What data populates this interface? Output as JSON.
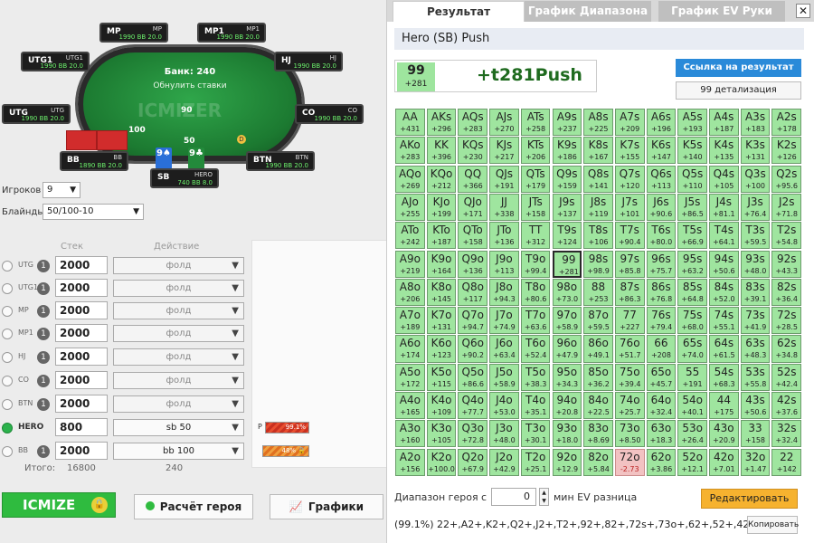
{
  "table": {
    "bank_label": "Банк: 240",
    "refresh_label": "Обнулить ставки",
    "watermark": "ICMIZER",
    "pot_chip": "90",
    "sb_chip": "50",
    "bb_chip": "100",
    "dealer": "D",
    "hero_cards": [
      "9♠",
      "9♣"
    ],
    "seats": [
      {
        "name": "MP",
        "tag": "MP",
        "stack": "1990 BB 20.0"
      },
      {
        "name": "MP1",
        "tag": "MP1",
        "stack": "1990 BB 20.0"
      },
      {
        "name": "UTG1",
        "tag": "UTG1",
        "stack": "1990 BB 20.0"
      },
      {
        "name": "HJ",
        "tag": "HJ",
        "stack": "1990 BB 20.0"
      },
      {
        "name": "UTG",
        "tag": "UTG",
        "stack": "1990 BB 20.0"
      },
      {
        "name": "CO",
        "tag": "CO",
        "stack": "1990 BB 20.0"
      },
      {
        "name": "BB",
        "tag": "BB",
        "stack": "1890 BB 20.0"
      },
      {
        "name": "BTN",
        "tag": "BTN",
        "stack": "1990 BB 20.0"
      },
      {
        "name": "SB",
        "tag": "HERO",
        "stack": "740 BB 8.0"
      }
    ]
  },
  "settings": {
    "players_label": "Игроков",
    "players_value": "9",
    "blinds_label": "Блайнды",
    "blinds_value": "50/100-10"
  },
  "players_header": {
    "stack": "Стек",
    "action": "Действие"
  },
  "players": [
    {
      "pos": "UTG",
      "num": "1",
      "stack": "2000",
      "action": "фолд",
      "active": false
    },
    {
      "pos": "UTG1",
      "num": "1",
      "stack": "2000",
      "action": "фолд",
      "active": false
    },
    {
      "pos": "MP",
      "num": "1",
      "stack": "2000",
      "action": "фолд",
      "active": false
    },
    {
      "pos": "MP1",
      "num": "1",
      "stack": "2000",
      "action": "фолд",
      "active": false
    },
    {
      "pos": "HJ",
      "num": "1",
      "stack": "2000",
      "action": "фолд",
      "active": false
    },
    {
      "pos": "CO",
      "num": "1",
      "stack": "2000",
      "action": "фолд",
      "active": false
    },
    {
      "pos": "BTN",
      "num": "1",
      "stack": "2000",
      "action": "фолд",
      "active": false
    },
    {
      "pos": "HERO",
      "num": "",
      "stack": "800",
      "action": "sb 50",
      "active": true
    },
    {
      "pos": "BB",
      "num": "1",
      "stack": "2000",
      "action": "bb 100",
      "active": false
    }
  ],
  "totals": {
    "label": "Итого:",
    "stack": "16800",
    "action": "240"
  },
  "equity": [
    {
      "label": "P",
      "value": "99.1%",
      "fraction": 0.991
    },
    {
      "label": "",
      "value": "48%",
      "fraction": 0.48
    }
  ],
  "buttons": {
    "icmize": "ICMIZE",
    "hero_calc": "Расчёт героя",
    "graphs": "Графики"
  },
  "panel": {
    "tabs": [
      "Результат",
      "График Диапазона",
      "График EV Руки"
    ],
    "close": "✕",
    "header": "Hero (SB) Push",
    "result_hand": "99",
    "result_ev": "+281",
    "result_big": "+t281Push",
    "link_button": "Ссылка на результат",
    "detail_button": "99 детализация",
    "range_label": "Диапазон героя с",
    "range_value": "0",
    "min_ev_label": "мин EV разница",
    "edit_button": "Редактировать",
    "range_string": "(99.1%) 22+,A2+,K2+,Q2+,J2+,T2+,92+,82+,72s+,73o+,62+,52+,42+,32",
    "copy_button": "Копировать"
  },
  "colors": {
    "push": "#9fe59f",
    "fold": "#f2c2c2",
    "accent": "#2a8ad9",
    "icmize": "#2fbb3f"
  },
  "grid": [
    [
      [
        "AA",
        "+431"
      ],
      [
        "AKs",
        "+296"
      ],
      [
        "AQs",
        "+283"
      ],
      [
        "AJs",
        "+270"
      ],
      [
        "ATs",
        "+258"
      ],
      [
        "A9s",
        "+237"
      ],
      [
        "A8s",
        "+225"
      ],
      [
        "A7s",
        "+209"
      ],
      [
        "A6s",
        "+196"
      ],
      [
        "A5s",
        "+193"
      ],
      [
        "A4s",
        "+187"
      ],
      [
        "A3s",
        "+183"
      ],
      [
        "A2s",
        "+178"
      ]
    ],
    [
      [
        "AKo",
        "+283"
      ],
      [
        "KK",
        "+396"
      ],
      [
        "KQs",
        "+230"
      ],
      [
        "KJs",
        "+217"
      ],
      [
        "KTs",
        "+206"
      ],
      [
        "K9s",
        "+186"
      ],
      [
        "K8s",
        "+167"
      ],
      [
        "K7s",
        "+155"
      ],
      [
        "K6s",
        "+147"
      ],
      [
        "K5s",
        "+140"
      ],
      [
        "K4s",
        "+135"
      ],
      [
        "K3s",
        "+131"
      ],
      [
        "K2s",
        "+126"
      ]
    ],
    [
      [
        "AQo",
        "+269"
      ],
      [
        "KQo",
        "+212"
      ],
      [
        "QQ",
        "+366"
      ],
      [
        "QJs",
        "+191"
      ],
      [
        "QTs",
        "+179"
      ],
      [
        "Q9s",
        "+159"
      ],
      [
        "Q8s",
        "+141"
      ],
      [
        "Q7s",
        "+120"
      ],
      [
        "Q6s",
        "+113"
      ],
      [
        "Q5s",
        "+110"
      ],
      [
        "Q4s",
        "+105"
      ],
      [
        "Q3s",
        "+100"
      ],
      [
        "Q2s",
        "+95.6"
      ]
    ],
    [
      [
        "AJo",
        "+255"
      ],
      [
        "KJo",
        "+199"
      ],
      [
        "QJo",
        "+171"
      ],
      [
        "JJ",
        "+338"
      ],
      [
        "JTs",
        "+158"
      ],
      [
        "J9s",
        "+137"
      ],
      [
        "J8s",
        "+119"
      ],
      [
        "J7s",
        "+101"
      ],
      [
        "J6s",
        "+90.6"
      ],
      [
        "J5s",
        "+86.5"
      ],
      [
        "J4s",
        "+81.1"
      ],
      [
        "J3s",
        "+76.4"
      ],
      [
        "J2s",
        "+71.8"
      ]
    ],
    [
      [
        "ATo",
        "+242"
      ],
      [
        "KTo",
        "+187"
      ],
      [
        "QTo",
        "+158"
      ],
      [
        "JTo",
        "+136"
      ],
      [
        "TT",
        "+312"
      ],
      [
        "T9s",
        "+124"
      ],
      [
        "T8s",
        "+106"
      ],
      [
        "T7s",
        "+90.4"
      ],
      [
        "T6s",
        "+80.0"
      ],
      [
        "T5s",
        "+66.9"
      ],
      [
        "T4s",
        "+64.1"
      ],
      [
        "T3s",
        "+59.5"
      ],
      [
        "T2s",
        "+54.8"
      ]
    ],
    [
      [
        "A9o",
        "+219"
      ],
      [
        "K9o",
        "+164"
      ],
      [
        "Q9o",
        "+136"
      ],
      [
        "J9o",
        "+113"
      ],
      [
        "T9o",
        "+99.4"
      ],
      [
        "99",
        "+281"
      ],
      [
        "98s",
        "+98.9"
      ],
      [
        "97s",
        "+85.8"
      ],
      [
        "96s",
        "+75.7"
      ],
      [
        "95s",
        "+63.2"
      ],
      [
        "94s",
        "+50.6"
      ],
      [
        "93s",
        "+48.0"
      ],
      [
        "92s",
        "+43.3"
      ]
    ],
    [
      [
        "A8o",
        "+206"
      ],
      [
        "K8o",
        "+145"
      ],
      [
        "Q8o",
        "+117"
      ],
      [
        "J8o",
        "+94.3"
      ],
      [
        "T8o",
        "+80.6"
      ],
      [
        "98o",
        "+73.0"
      ],
      [
        "88",
        "+253"
      ],
      [
        "87s",
        "+86.3"
      ],
      [
        "86s",
        "+76.8"
      ],
      [
        "85s",
        "+64.8"
      ],
      [
        "84s",
        "+52.0"
      ],
      [
        "83s",
        "+39.1"
      ],
      [
        "82s",
        "+36.4"
      ]
    ],
    [
      [
        "A7o",
        "+189"
      ],
      [
        "K7o",
        "+131"
      ],
      [
        "Q7o",
        "+94.7"
      ],
      [
        "J7o",
        "+74.9"
      ],
      [
        "T7o",
        "+63.6"
      ],
      [
        "97o",
        "+58.9"
      ],
      [
        "87o",
        "+59.5"
      ],
      [
        "77",
        "+227"
      ],
      [
        "76s",
        "+79.4"
      ],
      [
        "75s",
        "+68.0"
      ],
      [
        "74s",
        "+55.1"
      ],
      [
        "73s",
        "+41.9"
      ],
      [
        "72s",
        "+28.5"
      ]
    ],
    [
      [
        "A6o",
        "+174"
      ],
      [
        "K6o",
        "+123"
      ],
      [
        "Q6o",
        "+90.2"
      ],
      [
        "J6o",
        "+63.4"
      ],
      [
        "T6o",
        "+52.4"
      ],
      [
        "96o",
        "+47.9"
      ],
      [
        "86o",
        "+49.1"
      ],
      [
        "76o",
        "+51.7"
      ],
      [
        "66",
        "+208"
      ],
      [
        "65s",
        "+74.0"
      ],
      [
        "64s",
        "+61.5"
      ],
      [
        "63s",
        "+48.3"
      ],
      [
        "62s",
        "+34.8"
      ]
    ],
    [
      [
        "A5o",
        "+172"
      ],
      [
        "K5o",
        "+115"
      ],
      [
        "Q5o",
        "+86.6"
      ],
      [
        "J5o",
        "+58.9"
      ],
      [
        "T5o",
        "+38.3"
      ],
      [
        "95o",
        "+34.3"
      ],
      [
        "85o",
        "+36.2"
      ],
      [
        "75o",
        "+39.4"
      ],
      [
        "65o",
        "+45.7"
      ],
      [
        "55",
        "+191"
      ],
      [
        "54s",
        "+68.3"
      ],
      [
        "53s",
        "+55.8"
      ],
      [
        "52s",
        "+42.4"
      ]
    ],
    [
      [
        "A4o",
        "+165"
      ],
      [
        "K4o",
        "+109"
      ],
      [
        "Q4o",
        "+77.7"
      ],
      [
        "J4o",
        "+53.0"
      ],
      [
        "T4o",
        "+35.1"
      ],
      [
        "94o",
        "+20.8"
      ],
      [
        "84o",
        "+22.5"
      ],
      [
        "74o",
        "+25.7"
      ],
      [
        "64o",
        "+32.4"
      ],
      [
        "54o",
        "+40.1"
      ],
      [
        "44",
        "+175"
      ],
      [
        "43s",
        "+50.6"
      ],
      [
        "42s",
        "+37.6"
      ]
    ],
    [
      [
        "A3o",
        "+160"
      ],
      [
        "K3o",
        "+105"
      ],
      [
        "Q3o",
        "+72.8"
      ],
      [
        "J3o",
        "+48.0"
      ],
      [
        "T3o",
        "+30.1"
      ],
      [
        "93o",
        "+18.0"
      ],
      [
        "83o",
        "+8.69"
      ],
      [
        "73o",
        "+8.50"
      ],
      [
        "63o",
        "+18.3"
      ],
      [
        "53o",
        "+26.4"
      ],
      [
        "43o",
        "+20.9"
      ],
      [
        "33",
        "+158"
      ],
      [
        "32s",
        "+32.4"
      ]
    ],
    [
      [
        "A2o",
        "+156"
      ],
      [
        "K2o",
        "+100.0"
      ],
      [
        "Q2o",
        "+67.9"
      ],
      [
        "J2o",
        "+42.9"
      ],
      [
        "T2o",
        "+25.1"
      ],
      [
        "92o",
        "+12.9"
      ],
      [
        "82o",
        "+5.84"
      ],
      [
        "72o",
        "-2.73"
      ],
      [
        "62o",
        "+3.86"
      ],
      [
        "52o",
        "+12.1"
      ],
      [
        "42o",
        "+7.01"
      ],
      [
        "32o",
        "+1.47"
      ],
      [
        "22",
        "+142"
      ]
    ]
  ]
}
